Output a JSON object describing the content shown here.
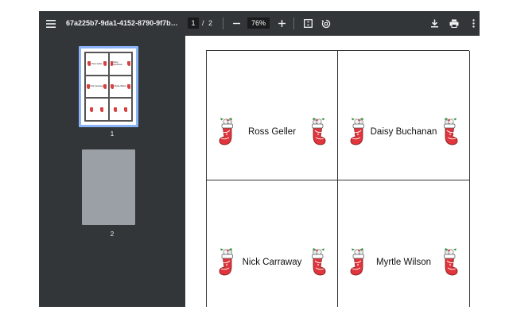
{
  "toolbar": {
    "menu_icon": "hamburger-menu-icon",
    "title": "67a225b7-9da1-4152-8790-9f7b…",
    "current_page": "1",
    "page_separator": "/",
    "total_pages": "2",
    "zoom_out_icon": "minus-icon",
    "zoom_level": "76%",
    "zoom_in_icon": "plus-icon",
    "fit_icon": "fit-to-page-icon",
    "rotate_icon": "rotate-icon",
    "download_icon": "download-icon",
    "print_icon": "print-icon",
    "more_icon": "more-vert-icon"
  },
  "sidebar": {
    "thumbnails": [
      {
        "number": "1",
        "selected": true
      },
      {
        "number": "2",
        "selected": false
      }
    ]
  },
  "page": {
    "cards": [
      {
        "name": "Ross Geller"
      },
      {
        "name": "Daisy Buchanan"
      },
      {
        "name": "Nick Carraway"
      },
      {
        "name": "Myrtle Wilson"
      }
    ]
  },
  "colors": {
    "toolbar": "#323639",
    "viewer_bg": "#525659",
    "thumb_selected": "#8ab4f8",
    "stocking_red": "#e0353d",
    "holly_green": "#2e8b3a"
  }
}
